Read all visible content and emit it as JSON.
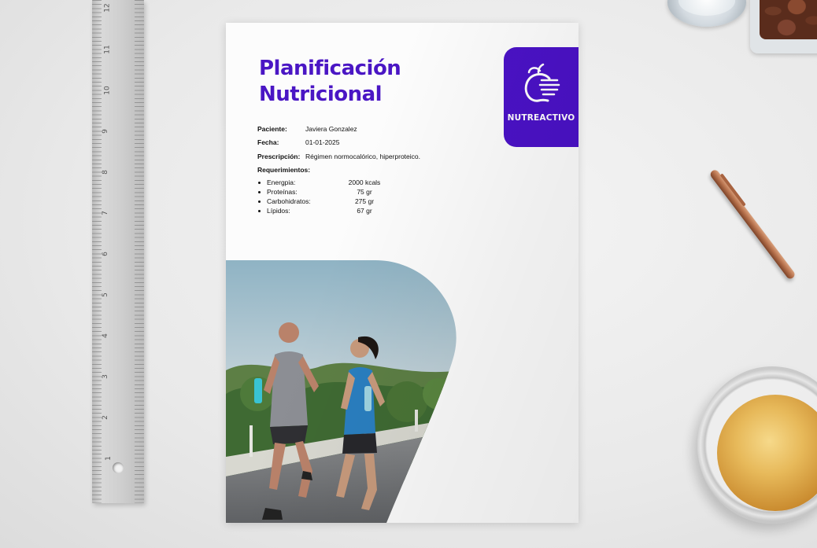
{
  "document": {
    "title": "Planificación Nutricional",
    "brand": "NUTREACTIVO",
    "fields": [
      {
        "label": "Paciente:",
        "value": "Javiera Gonzalez"
      },
      {
        "label": "Fecha:",
        "value": "01-01-2025"
      },
      {
        "label": "Prescripción:",
        "value": "Régimen normocalórico, hiperproteico."
      }
    ],
    "requirements_label": "Requerimientos:",
    "requirements": [
      {
        "name": "Energpia:",
        "amount": "2000 kcals"
      },
      {
        "name": "Proteínas:",
        "amount": "75 gr"
      },
      {
        "name": "Carbohidratos:",
        "amount": "275 gr"
      },
      {
        "name": "Lípidos:",
        "amount": "67 gr"
      }
    ]
  },
  "ruler": {
    "numbers": [
      "12",
      "11",
      "10",
      "9",
      "8",
      "7",
      "6",
      "5",
      "4",
      "3",
      "2",
      "1"
    ]
  },
  "colors": {
    "brand_purple": "#4b12c7",
    "title_purple": "#4a16c4"
  }
}
